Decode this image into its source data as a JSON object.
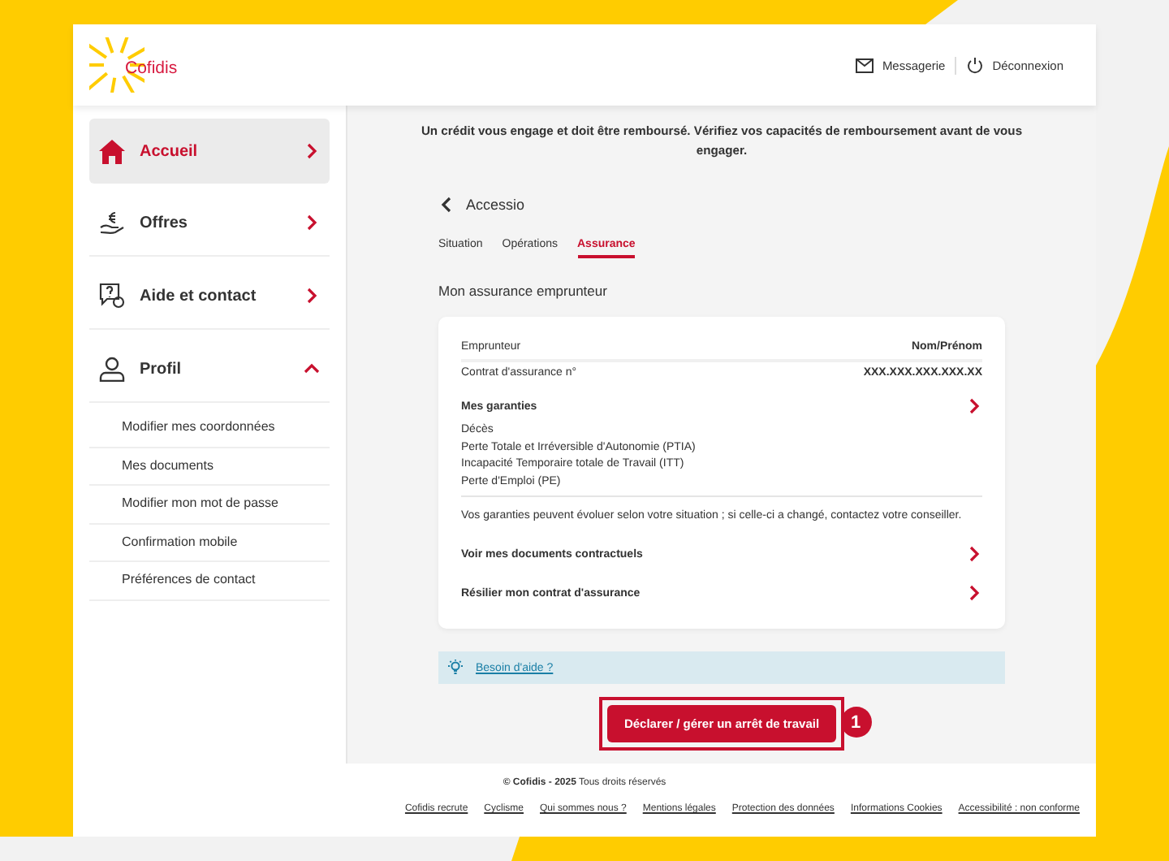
{
  "header": {
    "logo": "Cofidis",
    "links": [
      {
        "kind": "mail",
        "label": "Messagerie"
      },
      {
        "kind": "power",
        "label": "Déconnexion"
      }
    ]
  },
  "sidebar": {
    "items": [
      {
        "kind": "home",
        "label": "Accueil",
        "selected": true,
        "expanded": false
      },
      {
        "kind": "coin",
        "label": "Offres",
        "selected": false,
        "expanded": false
      },
      {
        "kind": "help",
        "label": "Aide et contact",
        "selected": false,
        "expanded": false
      },
      {
        "kind": "user",
        "label": "Profil",
        "selected": false,
        "expanded": true,
        "children": [
          "Modifier mes coordonnées",
          "Mes documents",
          "Modifier mon mot de passe",
          "Confirmation mobile",
          "Préférences de contact"
        ]
      }
    ]
  },
  "main": {
    "notice": "Un crédit vous engage et doit être remboursé. Vérifiez vos capacités de remboursement avant de vous engager.",
    "back": "Accessio",
    "tabs": [
      {
        "label": "Situation",
        "selected": false
      },
      {
        "label": "Opérations",
        "selected": false
      },
      {
        "label": "Assurance",
        "selected": true
      }
    ],
    "section_title": "Mon assurance emprunteur",
    "card": [
      {
        "kind": "pair",
        "label": "Emprunteur",
        "value": "Nom/Prénom"
      },
      {
        "kind": "pair",
        "label": "Contrat d'assurance n°",
        "value": "XXX.XXX.XXX.XXX.XX"
      },
      {
        "kind": "list",
        "title": "Mes garanties",
        "items": [
          "Décès",
          "Perte Totale  et Irréversible d'Autonomie (PTIA)",
          "Incapacité Temporaire totale de Travail (ITT)",
          "Perte d'Emploi (PE)"
        ]
      },
      {
        "kind": "note",
        "text": "Vos garanties peuvent évoluer selon votre situation ; si celle-ci a changé, contactez votre conseiller."
      },
      {
        "kind": "link",
        "label": "Voir mes documents contractuels"
      },
      {
        "kind": "link",
        "label": "Résilier mon contrat d'assurance"
      }
    ],
    "help": "Besoin d'aide ?",
    "action_button": "Déclarer / gérer un arrêt de travail",
    "callout": "1"
  },
  "footer": {
    "copyright": "**© Cofidis - 2025** Tous droits réservés",
    "links": [
      "Cofidis recrute",
      "Cyclisme",
      "Qui sommes nous ?",
      "Mentions légales",
      "Protection des données",
      "Informations Cookies",
      "Accessibilité : non conforme"
    ]
  }
}
